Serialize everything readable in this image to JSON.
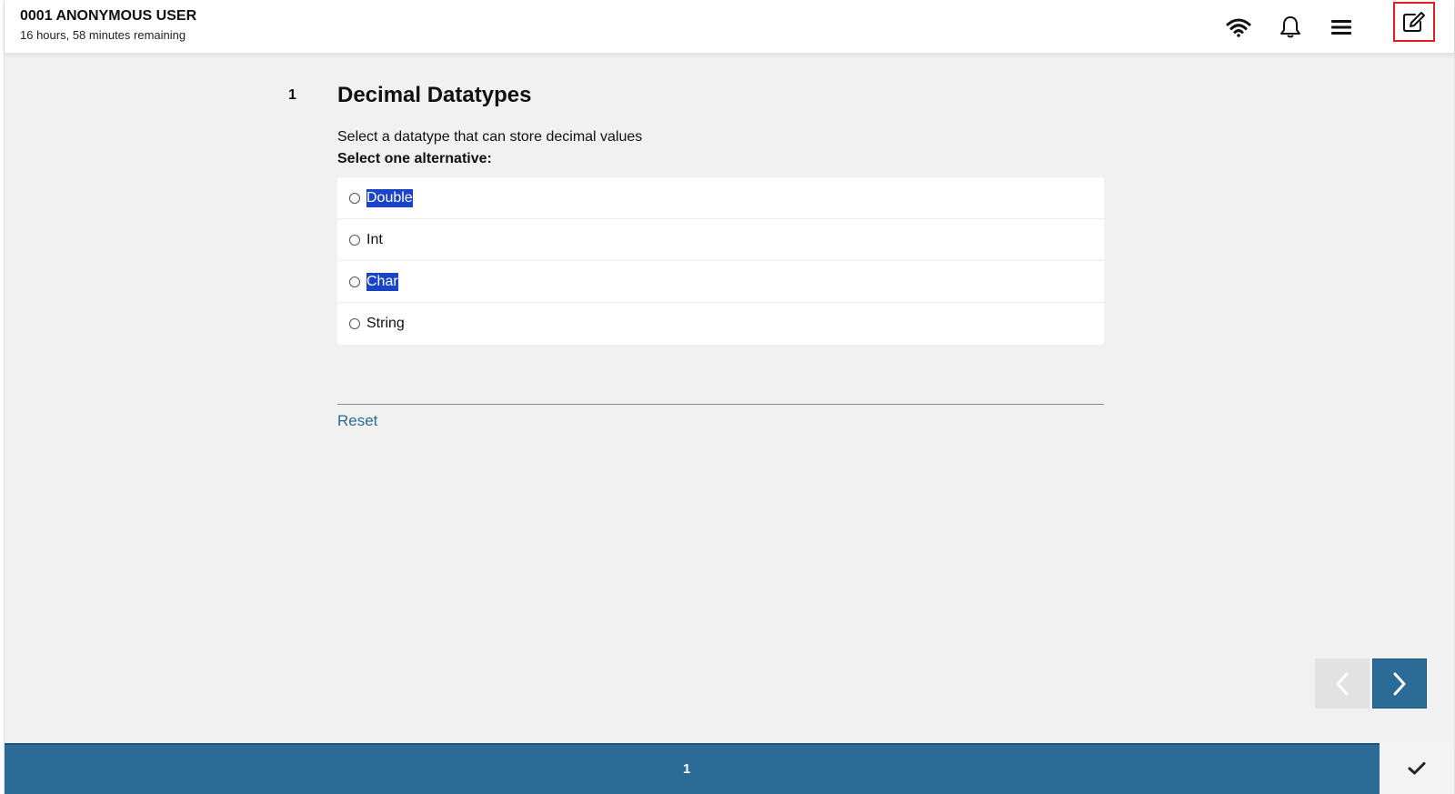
{
  "header": {
    "user_name": "0001 ANONYMOUS USER",
    "time_remaining": "16 hours, 58 minutes remaining",
    "icons": [
      "wifi-icon",
      "bell-icon",
      "menu-icon",
      "edit-icon"
    ],
    "highlight_color": "#e31b23"
  },
  "question": {
    "number": "1",
    "title": "Decimal Datatypes",
    "text": "Select a datatype that can store decimal values",
    "instruction": "Select one alternative:",
    "options": [
      {
        "label": "Double",
        "text_highlighted": true
      },
      {
        "label": "Int",
        "text_highlighted": false
      },
      {
        "label": "Char",
        "text_highlighted": true
      },
      {
        "label": "String",
        "text_highlighted": false
      }
    ],
    "reset_label": "Reset"
  },
  "navigation": {
    "prev_icon": "chevron-left-icon",
    "next_icon": "chevron-right-icon",
    "prev_enabled": false
  },
  "footer": {
    "page_indicator": "1",
    "submit_icon": "checkmark-icon"
  },
  "colors": {
    "accent": "#2b6b96",
    "background": "#f1f1f1",
    "selection": "#1a44c8"
  }
}
